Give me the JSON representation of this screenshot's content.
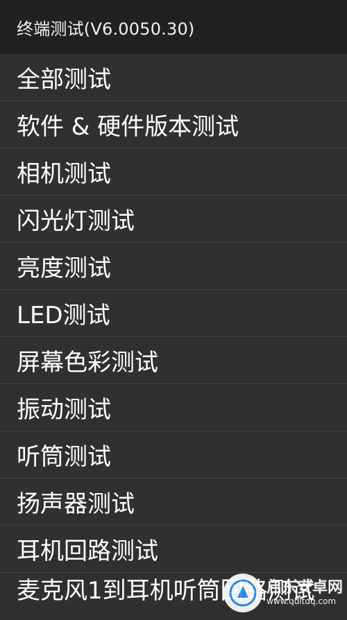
{
  "app_bar": {
    "title": "终端测试(V6.0050.30)"
  },
  "menu": {
    "items": [
      {
        "label": "全部测试"
      },
      {
        "label": "软件 & 硬件版本测试"
      },
      {
        "label": "相机测试"
      },
      {
        "label": "闪光灯测试"
      },
      {
        "label": "亮度测试"
      },
      {
        "label": "LED测试"
      },
      {
        "label": "屏幕色彩测试"
      },
      {
        "label": "振动测试"
      },
      {
        "label": "听筒测试"
      },
      {
        "label": "扬声器测试"
      },
      {
        "label": "耳机回路测试"
      },
      {
        "label": "麦克风1到耳机听筒回路测试"
      }
    ]
  },
  "watermark": {
    "name": "启东安卓网",
    "url": "www.qdltdq.com",
    "logo_color": "#2a8ee8"
  },
  "colors": {
    "app_bar_bg": "#212121",
    "list_bg": "#303030",
    "divider": "#444444",
    "text": "#ffffff"
  }
}
